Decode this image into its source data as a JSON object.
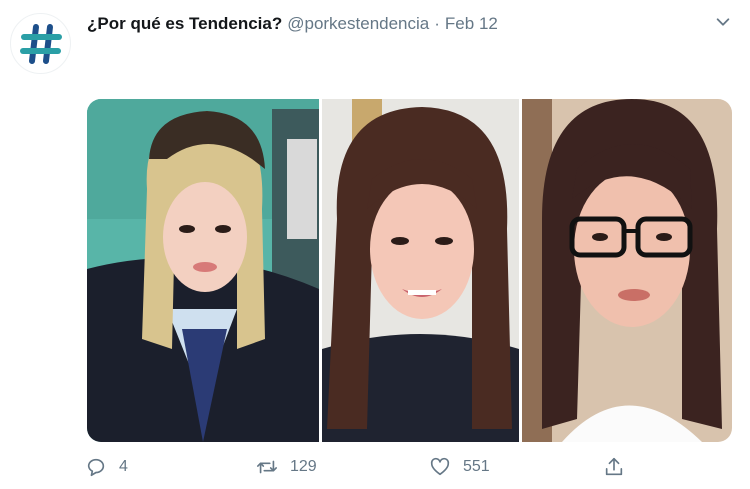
{
  "tweet": {
    "display_name": "¿Por qué es Tendencia?",
    "handle": "@porkestendencia",
    "separator": "·",
    "timestamp": "Feb 12",
    "avatar_icon": "hashtag-icon",
    "avatar_colors": {
      "primary": "#2a9fa6",
      "secondary": "#1d4f8a"
    },
    "media": [
      {
        "name": "photo-blonde-bob-uniform",
        "description_icon": "portrait-photo"
      },
      {
        "name": "photo-brunette-smiling",
        "description_icon": "portrait-photo"
      },
      {
        "name": "photo-glasses-long-hair",
        "description_icon": "portrait-photo"
      }
    ],
    "actions": {
      "reply": {
        "icon": "reply-icon",
        "count": "4"
      },
      "retweet": {
        "icon": "retweet-icon",
        "count": "129"
      },
      "like": {
        "icon": "heart-icon",
        "count": "551"
      },
      "share": {
        "icon": "share-icon"
      }
    },
    "colors": {
      "text": "#14171a",
      "muted": "#657786"
    }
  }
}
